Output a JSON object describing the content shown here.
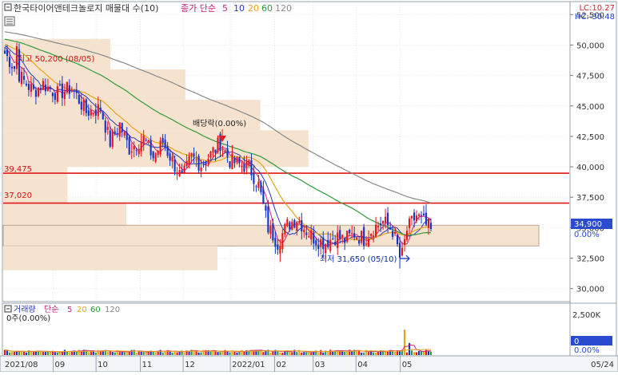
{
  "header": {
    "title": "한국타이어앤테크놀로지 매물대 수(10)",
    "ma_label": "종가 단순",
    "ma_periods": [
      "5",
      "10",
      "20",
      "60",
      "120"
    ],
    "ma_colors": [
      "#d4237a",
      "#2a3ab5",
      "#e8a417",
      "#2f9a3a",
      "#888888"
    ],
    "lc_label": "LC:10.27",
    "hc_label": "HC:-30.48"
  },
  "volume_header": {
    "title": "거래량",
    "ma_label": "단순",
    "ma_periods": [
      "5",
      "20",
      "60",
      "120"
    ],
    "ma_colors": [
      "#d4237a",
      "#e8a417",
      "#2f9a3a",
      "#888888"
    ],
    "current_label": "0주(0.00%)"
  },
  "price_axis": {
    "labels": [
      "52,500",
      "50,000",
      "47,500",
      "45,000",
      "42,500",
      "40,000",
      "37,500",
      "35,000",
      "32,500",
      "30,000"
    ],
    "values": [
      52500,
      50000,
      47500,
      45000,
      42500,
      40000,
      37500,
      35000,
      32500,
      30000
    ],
    "current_price_label": "34,900",
    "current_change_label": "0.00%"
  },
  "volume_axis": {
    "labels": [
      "2,500K",
      "0"
    ],
    "current_volume_label": "0",
    "current_change_label": "0.00%"
  },
  "date_axis": {
    "labels": [
      "2021/08",
      "09",
      "10",
      "11",
      "12",
      "2022/01",
      "02",
      "03",
      "04",
      "05"
    ],
    "right_label": "05/24"
  },
  "annotations": {
    "high": "최고 50,200 (08/05)",
    "low": "최저 31,650 (05/10)",
    "dividend": "배당락(0.00%)",
    "line1_label": "39,475",
    "line2_label": "37,020"
  },
  "chart_data": {
    "type": "candlestick",
    "x_range": [
      "2021/07/28",
      "2022/05/24"
    ],
    "ylim": [
      29000,
      53500
    ],
    "volume_ylim": [
      0,
      2800000
    ],
    "horizontal_lines": [
      39475,
      37020
    ],
    "high": {
      "value": 50200,
      "date": "2021/08/05"
    },
    "low": {
      "value": 31650,
      "date": "2022/05/10"
    },
    "last_price": 34900,
    "sma_periods": [
      5,
      10,
      20,
      60,
      120
    ],
    "price_path": [
      [
        0,
        49300
      ],
      [
        8,
        47000
      ],
      [
        12,
        46200
      ],
      [
        16,
        46800
      ],
      [
        22,
        46000
      ],
      [
        28,
        46500
      ],
      [
        34,
        44500
      ],
      [
        40,
        44800
      ],
      [
        44,
        42000
      ],
      [
        48,
        43500
      ],
      [
        52,
        41500
      ],
      [
        58,
        42300
      ],
      [
        62,
        40800
      ],
      [
        66,
        42000
      ],
      [
        70,
        40500
      ],
      [
        74,
        39000
      ],
      [
        78,
        40800
      ],
      [
        82,
        40200
      ],
      [
        86,
        41000
      ],
      [
        90,
        42000
      ],
      [
        94,
        40500
      ],
      [
        98,
        40200
      ],
      [
        102,
        40000
      ],
      [
        106,
        38500
      ],
      [
        110,
        35000
      ],
      [
        114,
        33800
      ],
      [
        118,
        35200
      ],
      [
        122,
        35800
      ],
      [
        126,
        34800
      ],
      [
        130,
        34000
      ],
      [
        134,
        33800
      ],
      [
        138,
        34300
      ],
      [
        142,
        34000
      ],
      [
        146,
        34500
      ],
      [
        150,
        34100
      ],
      [
        154,
        35000
      ],
      [
        158,
        35500
      ],
      [
        162,
        34800
      ],
      [
        164,
        33400
      ],
      [
        166,
        32800
      ],
      [
        168,
        34800
      ],
      [
        172,
        36000
      ],
      [
        176,
        35200
      ],
      [
        178,
        34900
      ]
    ],
    "volume_profile": [
      {
        "price_low": 48000,
        "price_high": 50500,
        "volume_rel": 0.2
      },
      {
        "price_low": 45500,
        "price_high": 48000,
        "volume_rel": 0.34
      },
      {
        "price_low": 43000,
        "price_high": 45500,
        "volume_rel": 0.48
      },
      {
        "price_low": 40000,
        "price_high": 43000,
        "volume_rel": 0.57
      },
      {
        "price_low": 37000,
        "price_high": 40000,
        "volume_rel": 0.12
      },
      {
        "price_low": 35200,
        "price_high": 37000,
        "volume_rel": 0.23
      },
      {
        "price_low": 33500,
        "price_high": 35200,
        "volume_rel": 1.0
      },
      {
        "price_low": 31500,
        "price_high": 33500,
        "volume_rel": 0.4
      }
    ],
    "volume_spikes": [
      {
        "day": 167,
        "volume": 1900000
      },
      {
        "day": 169,
        "volume": 900000
      }
    ]
  }
}
